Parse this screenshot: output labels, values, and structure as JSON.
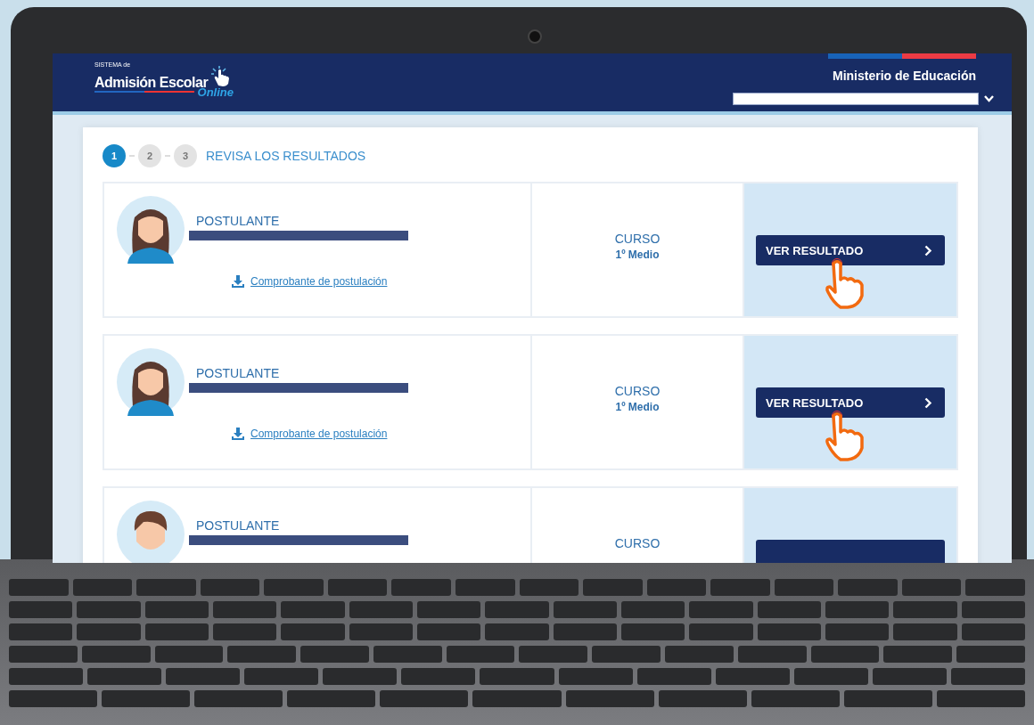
{
  "header": {
    "logo": {
      "small": "SISTEMA de",
      "main": "Admisión Escolar",
      "script": "Online"
    },
    "ministry": "Ministerio de Educación"
  },
  "steps": [
    {
      "label": "1",
      "selected": true
    },
    {
      "label": "2",
      "selected": false
    },
    {
      "label": "3",
      "selected": false
    }
  ],
  "step_title": "REVISA LOS RESULTADOS",
  "cards": [
    {
      "label": "POSTULANTE",
      "kind": "girl",
      "link": "Comprobante de postulación",
      "course_label": "CURSO",
      "course": "1º Medio",
      "button": "VER RESULTADO",
      "pointer": true
    },
    {
      "label": "POSTULANTE",
      "kind": "girl",
      "link": "Comprobante de postulación",
      "course_label": "CURSO",
      "course": "1º Medio",
      "button": "VER RESULTADO",
      "pointer": true
    },
    {
      "label": "POSTULANTE",
      "kind": "boy",
      "course_label": "CURSO",
      "pointer": false
    }
  ]
}
